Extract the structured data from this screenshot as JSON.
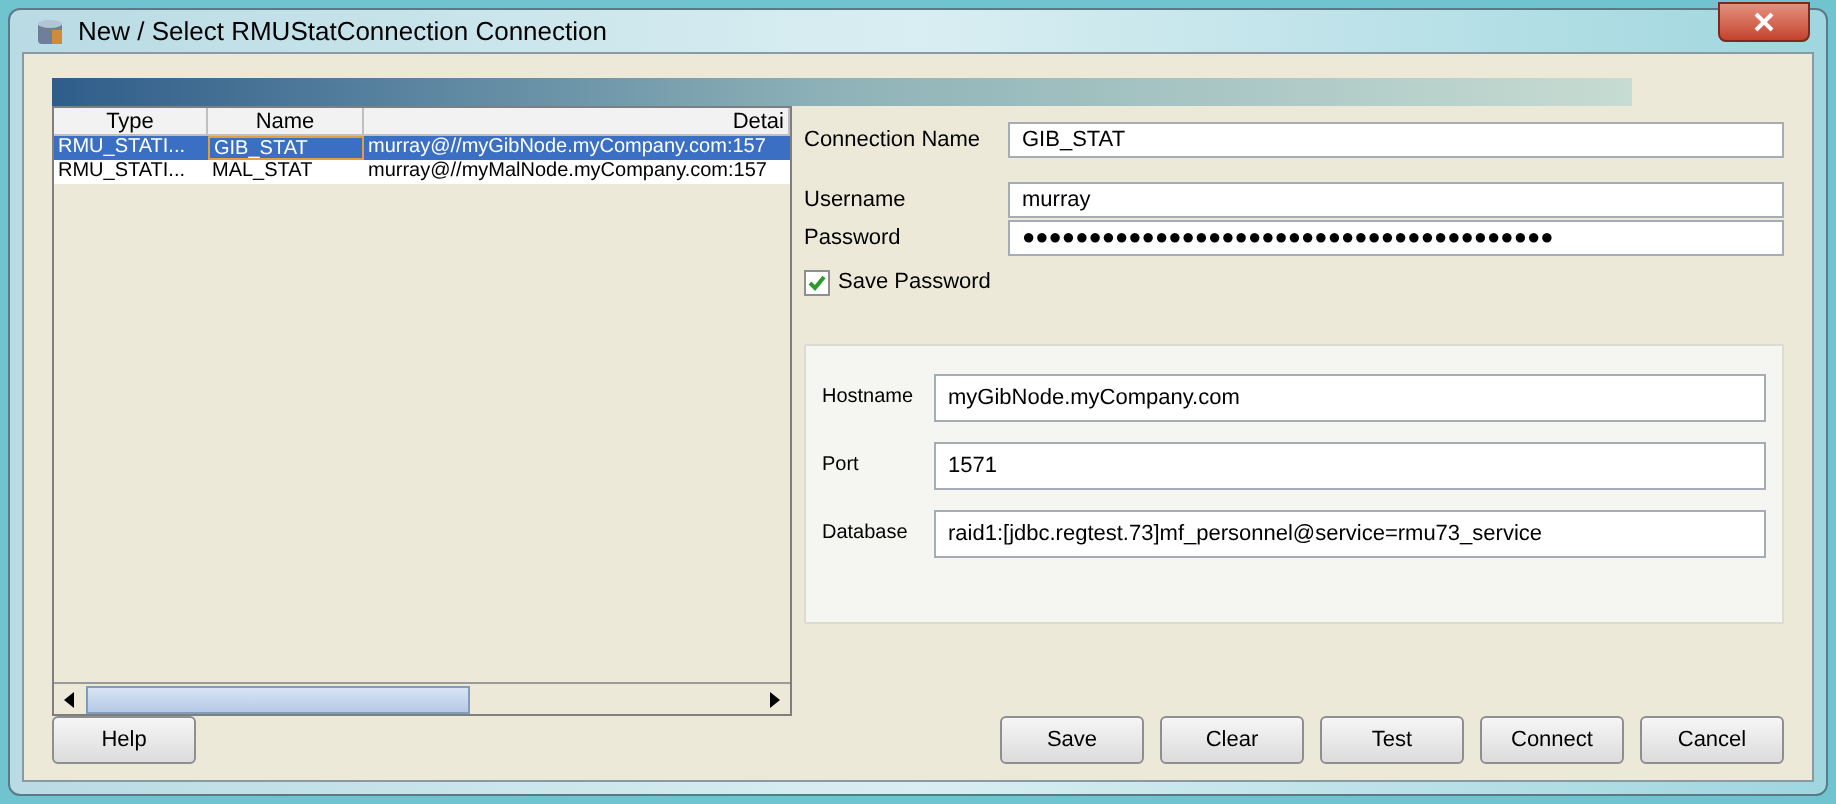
{
  "window": {
    "title": "New / Select RMUStatConnection Connection"
  },
  "table": {
    "columns": [
      "Type",
      "Name",
      "Detai"
    ],
    "rows": [
      {
        "cells": [
          "RMU_STATI...",
          "GIB_STAT",
          "murray@//myGibNode.myCompany.com:157"
        ],
        "selected": true
      },
      {
        "cells": [
          "RMU_STATI...",
          "MAL_STAT",
          "murray@//myMalNode.myCompany.com:157"
        ],
        "selected": false
      }
    ]
  },
  "connection": {
    "fields": [
      {
        "label": "Connection Name",
        "value": "GIB_STAT"
      },
      {
        "label": "Username",
        "value": "murray"
      },
      {
        "label": "Password",
        "value": "●●●●●●●●●●●●●●●●●●●●●●●●●●●●●●●●●●●●●●●●"
      }
    ],
    "save_password": {
      "label": "Save Password",
      "checked": true
    }
  },
  "server": {
    "fields": [
      {
        "label": "Hostname",
        "value": "myGibNode.myCompany.com"
      },
      {
        "label": "Port",
        "value": "1571"
      },
      {
        "label": "Database",
        "value": "raid1:[jdbc.regtest.73]mf_personnel@service=rmu73_service"
      }
    ]
  },
  "buttons_left": [
    "Help"
  ],
  "buttons_right": [
    "Save",
    "Clear",
    "Test",
    "Connect",
    "Cancel"
  ]
}
